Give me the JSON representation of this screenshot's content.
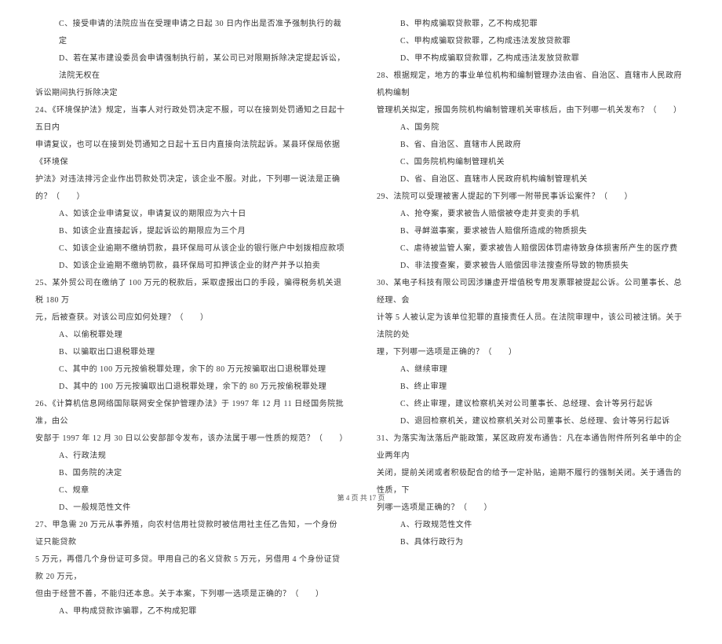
{
  "left_column": [
    {
      "class": "line option",
      "text": "C、接受申请的法院应当在受理申请之日起 30 日内作出是否准予强制执行的裁定"
    },
    {
      "class": "line option",
      "text": "D、若在某市建设委员会申请强制执行前，某公司已对限期拆除决定提起诉讼，法院无权在"
    },
    {
      "class": "line",
      "text": "诉讼期间执行拆除决定"
    },
    {
      "class": "line",
      "text": "24、《环境保护法》规定，当事人对行政处罚决定不服，可以在接到处罚通知之日起十五日内"
    },
    {
      "class": "line",
      "text": "申请复议，也可以在接到处罚通知之日起十五日内直接向法院起诉。某县环保局依据《环境保"
    },
    {
      "class": "line",
      "text": "护法》对违法排污企业作出罚款处罚决定，该企业不服。对此，下列哪一说法是正确的？（　　）"
    },
    {
      "class": "line option",
      "text": "A、如该企业申请复议，申请复议的期限应为六十日"
    },
    {
      "class": "line option",
      "text": "B、如该企业直接起诉，提起诉讼的期限应为三个月"
    },
    {
      "class": "line option",
      "text": "C、如该企业逾期不缴纳罚款，县环保局可从该企业的银行账户中划拨相应款项"
    },
    {
      "class": "line option",
      "text": "D、如该企业逾期不缴纳罚款，县环保局可扣押该企业的财产并予以拍卖"
    },
    {
      "class": "line",
      "text": "25、某外贸公司在缴纳了 100 万元的税款后，采取虚报出口的手段，骗得税务机关退税 180 万"
    },
    {
      "class": "line",
      "text": "元，后被查获。对该公司应如何处理？（　　）"
    },
    {
      "class": "line option",
      "text": "A、以偷税罪处理"
    },
    {
      "class": "line option",
      "text": "B、以骗取出口退税罪处理"
    },
    {
      "class": "line option",
      "text": "C、其中的 100 万元按偷税罪处理，余下的 80 万元按骗取出口退税罪处理"
    },
    {
      "class": "line option",
      "text": "D、其中的 100 万元按骗取出口退税罪处理，余下的 80 万元按偷税罪处理"
    },
    {
      "class": "line",
      "text": "26、《计算机信息网络国际联网安全保护管理办法》于 1997 年 12 月 11 日经国务院批准，由公"
    },
    {
      "class": "line",
      "text": "安部于 1997 年 12 月 30 日以公安部部令发布，该办法属于哪一性质的规范？（　　）"
    },
    {
      "class": "line option",
      "text": "A、行政法规"
    },
    {
      "class": "line option",
      "text": "B、国务院的决定"
    },
    {
      "class": "line option",
      "text": "C、规章"
    },
    {
      "class": "line option",
      "text": "D、一般规范性文件"
    },
    {
      "class": "line",
      "text": "27、甲急需 20 万元从事养殖，向农村信用社贷款时被信用社主任乙告知，一个身份证只能贷款"
    },
    {
      "class": "line",
      "text": "5 万元，再借几个身份证可多贷。甲用自己的名义贷款 5 万元，另借用 4 个身份证贷款 20 万元，"
    },
    {
      "class": "line",
      "text": "但由于经营不善，不能归还本息。关于本案，下列哪一选项是正确的？（　　）"
    },
    {
      "class": "line option",
      "text": "A、甲构成贷款诈骗罪，乙不构成犯罪"
    }
  ],
  "right_column": [
    {
      "class": "line option",
      "text": "B、甲构成骗取贷款罪，乙不构成犯罪"
    },
    {
      "class": "line option",
      "text": "C、甲构成骗取贷款罪，乙构成违法发放贷款罪"
    },
    {
      "class": "line option",
      "text": "D、甲不构成骗取贷款罪，乙构成违法发放贷款罪"
    },
    {
      "class": "line",
      "text": "28、根据规定，地方的事业单位机构和编制管理办法由省、自治区、直辖市人民政府机构编制"
    },
    {
      "class": "line",
      "text": "管理机关拟定，报国务院机构编制管理机关审核后，由下列哪一机关发布？（　　）"
    },
    {
      "class": "line option",
      "text": "A、国务院"
    },
    {
      "class": "line option",
      "text": "B、省、自治区、直辖市人民政府"
    },
    {
      "class": "line option",
      "text": "C、国务院机构编制管理机关"
    },
    {
      "class": "line option",
      "text": "D、省、自治区、直辖市人民政府机构编制管理机关"
    },
    {
      "class": "line",
      "text": "29、法院可以受理被害人提起的下列哪一附带民事诉讼案件？（　　）"
    },
    {
      "class": "line option",
      "text": "A、抢夺案，要求被告人赔偿被夺走并变卖的手机"
    },
    {
      "class": "line option",
      "text": "B、寻衅滋事案，要求被告人赔偿所造成的物质损失"
    },
    {
      "class": "line option",
      "text": "C、虐待被监管人案，要求被告人赔偿因体罚虐待致身体损害所产生的医疗费"
    },
    {
      "class": "line option",
      "text": "D、非法搜查案，要求被告人赔偿因非法搜查所导致的物质损失"
    },
    {
      "class": "line",
      "text": "30、某电子科技有限公司因涉嫌虚开增值税专用发票罪被提起公诉。公司董事长、总经理、会"
    },
    {
      "class": "line",
      "text": "计等 5 人被认定为该单位犯罪的直接责任人员。在法院审理中，该公司被注销。关于法院的处"
    },
    {
      "class": "line",
      "text": "理，下列哪一选项是正确的？（　　）"
    },
    {
      "class": "line option",
      "text": "A、继续审理"
    },
    {
      "class": "line option",
      "text": "B、终止审理"
    },
    {
      "class": "line option",
      "text": "C、终止审理，建议检察机关对公司董事长、总经理、会计等另行起诉"
    },
    {
      "class": "line option",
      "text": "D、退回检察机关，建议检察机关对公司董事长、总经理、会计等另行起诉"
    },
    {
      "class": "line",
      "text": "31、为落实淘汰落后产能政策，某区政府发布通告：凡在本通告附件所列名单中的企业两年内"
    },
    {
      "class": "line",
      "text": "关闭，提前关闭或者积极配合的给予一定补贴，逾期不履行的强制关闭。关于通告的性质，下"
    },
    {
      "class": "line",
      "text": "列哪一选项是正确的？（　　）"
    },
    {
      "class": "line option",
      "text": "A、行政规范性文件"
    },
    {
      "class": "line option",
      "text": "B、具体行政行为"
    }
  ],
  "footer": "第 4 页 共 17 页"
}
